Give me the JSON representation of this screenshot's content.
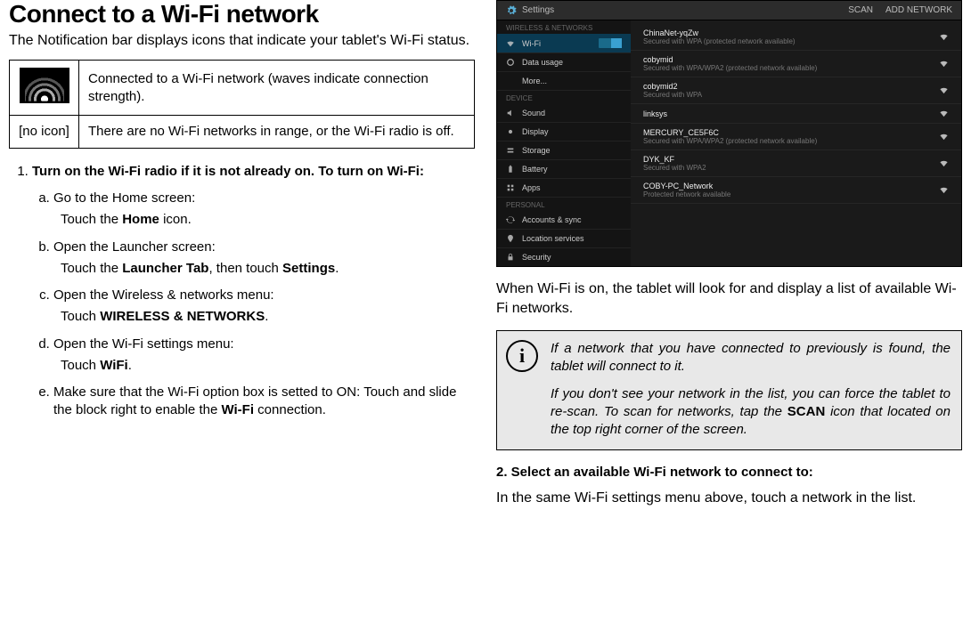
{
  "left": {
    "heading": "Connect to a Wi-Fi network",
    "intro": "The Notification bar displays icons that indicate your tablet's Wi-Fi status.",
    "icon_table": {
      "row1_desc": "Connected to a Wi-Fi network (waves indicate connection strength).",
      "row2_label": "[no icon]",
      "row2_desc": "There are no Wi-Fi networks in range, or the Wi-Fi radio is off."
    },
    "step1_title": "Turn on the Wi-Fi radio if it is not already on. To turn on Wi-Fi:",
    "sub": {
      "a_head": "Go to the Home screen:",
      "a_body_pre": "Touch the ",
      "a_body_bold": "Home",
      "a_body_post": " icon.",
      "b_head": "Open the Launcher screen:",
      "b_body_pre": "Touch the ",
      "b_body_bold1": "Launcher Tab",
      "b_body_mid": ", then touch ",
      "b_body_bold2": "Settings",
      "b_body_post": ".",
      "c_head": "Open the Wireless & networks menu:",
      "c_body_pre": "Touch ",
      "c_body_bold": "WIRELESS & NETWORKS",
      "c_body_post": ".",
      "d_head": "Open the Wi-Fi settings menu:",
      "d_body_pre": "Touch ",
      "d_body_bold": "WiFi",
      "d_body_post": ".",
      "e_body_pre": "Make sure that the Wi-Fi option box is setted to ON:  Touch and slide the block right to enable the ",
      "e_body_bold": "Wi-Fi",
      "e_body_post": " connection."
    }
  },
  "right": {
    "settings_title": "Settings",
    "top_scan": "SCAN",
    "top_add": "ADD NETWORK",
    "side": {
      "cat1": "WIRELESS & NETWORKS",
      "wifi": "Wi-Fi",
      "wifi_on": "ON",
      "data": "Data usage",
      "more": "More...",
      "cat2": "DEVICE",
      "sound": "Sound",
      "display": "Display",
      "storage": "Storage",
      "battery": "Battery",
      "apps": "Apps",
      "cat3": "PERSONAL",
      "accounts": "Accounts & sync",
      "location": "Location services",
      "security": "Security"
    },
    "nets": [
      {
        "name": "ChinaNet-yqZw",
        "sub": "Secured with WPA (protected network available)"
      },
      {
        "name": "cobymid",
        "sub": "Secured with WPA/WPA2 (protected network available)"
      },
      {
        "name": "cobymid2",
        "sub": "Secured with WPA"
      },
      {
        "name": "linksys",
        "sub": ""
      },
      {
        "name": "MERCURY_CE5F6C",
        "sub": "Secured with WPA/WPA2 (protected network available)"
      },
      {
        "name": "DYK_KF",
        "sub": "Secured with WPA2"
      },
      {
        "name": "COBY-PC_Network",
        "sub": "Protected network available"
      }
    ],
    "after_shot": "When Wi-Fi is on, the tablet will look for and display a list of available Wi-Fi networks.",
    "note_p1": "If a network that you have connected to previously is found, the tablet will connect to it.",
    "note_p2_pre": "If you don't see your network in the list, you can force the tablet to re-scan. To scan for networks, tap the ",
    "note_p2_bold": "SCAN",
    "note_p2_post": " icon that located on the top right corner of the screen.",
    "step2_title": "2.    Select an available Wi-Fi network to connect to:",
    "step2_body": "In the same Wi-Fi settings menu above, touch a network in the list."
  }
}
